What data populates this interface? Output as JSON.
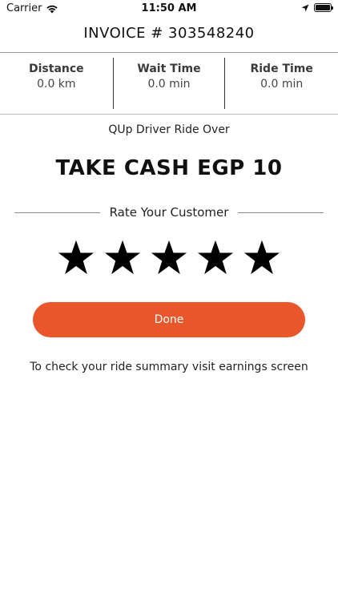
{
  "status_bar": {
    "carrier": "Carrier",
    "time": "11:50 AM"
  },
  "invoice": {
    "title": "INVOICE # 303548240"
  },
  "stats": [
    {
      "label": "Distance",
      "value": "0.0 km"
    },
    {
      "label": "Wait Time",
      "value": "0.0 min"
    },
    {
      "label": "Ride Time",
      "value": "0.0 min"
    }
  ],
  "ride": {
    "status_text": "QUp Driver Ride Over",
    "take_cash": "TAKE CASH EGP 10"
  },
  "rating": {
    "heading": "Rate Your Customer",
    "max_stars": 5,
    "selected_stars": 5
  },
  "actions": {
    "done_label": "Done"
  },
  "footer": {
    "summary_text": "To check your ride summary visit earnings screen"
  },
  "colors": {
    "accent": "#e9562a",
    "star": "#000000",
    "text": "#111111"
  }
}
